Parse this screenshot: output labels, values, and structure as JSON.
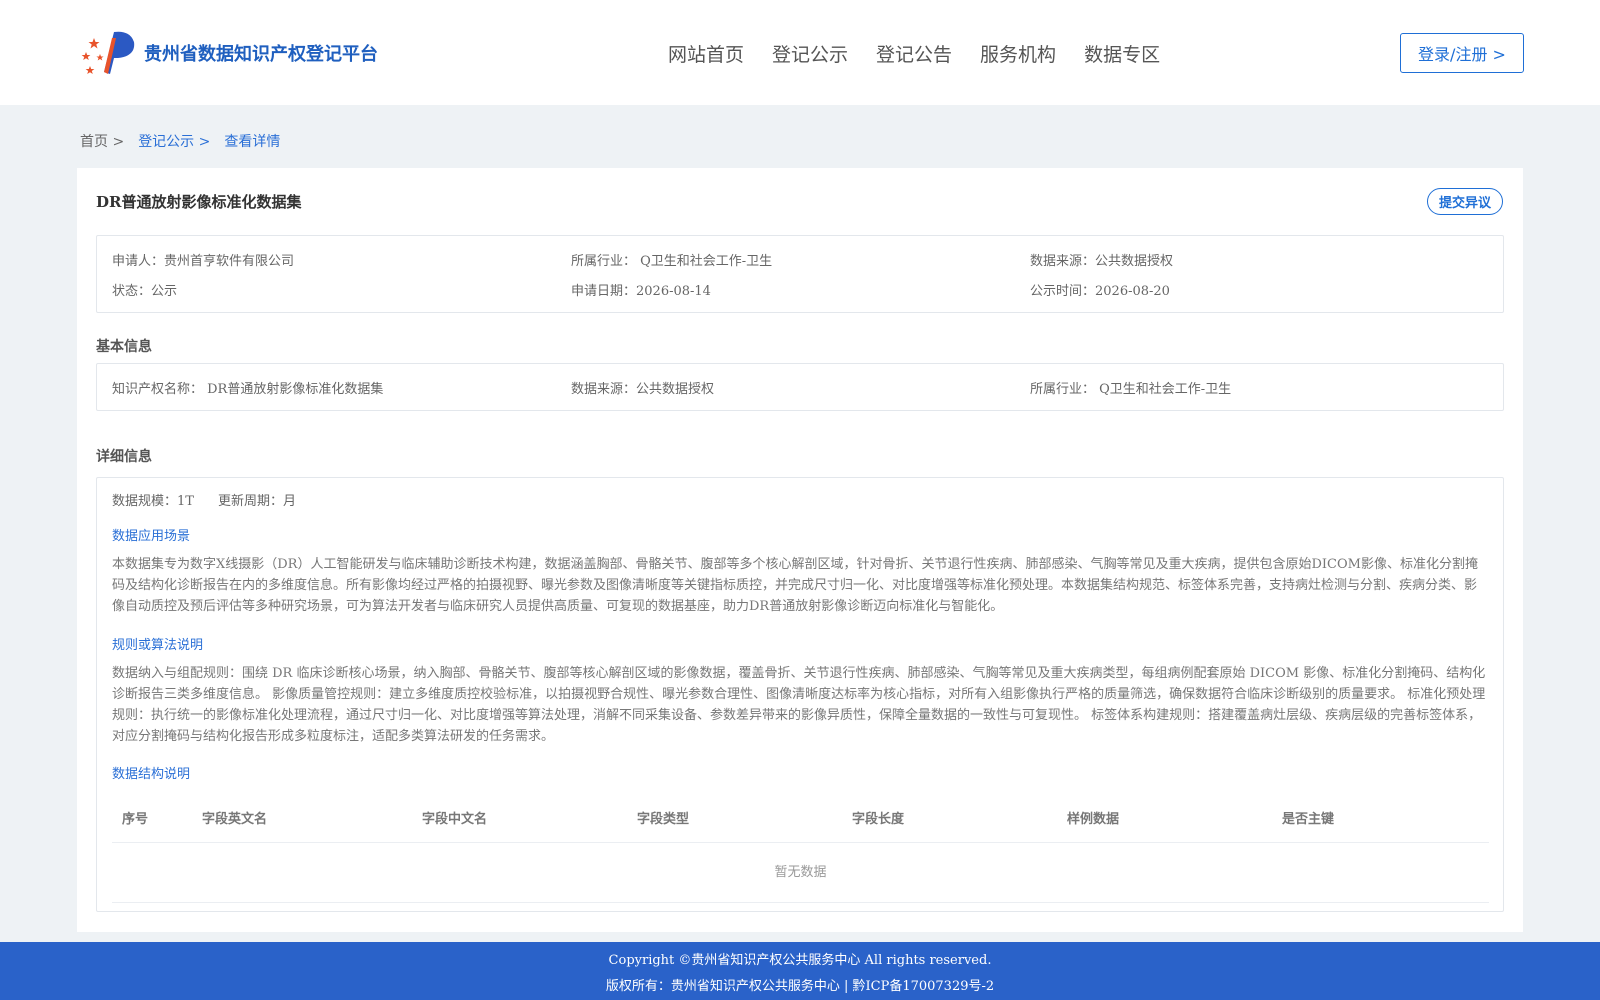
{
  "header": {
    "logo_icon": "platform-logo-icon",
    "platform_name": "贵州省数据知识产权登记平台",
    "nav": [
      "网站首页",
      "登记公示",
      "登记公告",
      "服务机构",
      "数据专区"
    ],
    "login_label": "登录/注册 >"
  },
  "breadcrumb": {
    "home": "首页 >",
    "list": "登记公示 >",
    "current": "查看详情"
  },
  "detail": {
    "title": "DR普通放射影像标准化数据集",
    "objection_label": "提交异议",
    "summary": {
      "applicant": "申请人：贵州首亨软件有限公司",
      "industry": "所属行业： Q卫生和社会工作-卫生",
      "source": "数据来源：公共数据授权",
      "status": "状态：公示",
      "apply_date": "申请日期：2026-08-14",
      "publish_time": "公示时间：2026-08-20"
    },
    "basic_title": "基本信息",
    "basic": {
      "ip_name": "知识产权名称： DR普通放射影像标准化数据集",
      "source": "数据来源：公共数据授权",
      "industry": "所属行业： Q卫生和社会工作-卫生"
    },
    "detail_title": "详细信息",
    "scale": "数据规模：1T",
    "update_cycle": "更新周期：月",
    "scenario_title": "数据应用场景",
    "scenario_text": "本数据集专为数字X线摄影（DR）人工智能研发与临床辅助诊断技术构建，数据涵盖胸部、骨骼关节、腹部等多个核心解剖区域，针对骨折、关节退行性疾病、肺部感染、气胸等常见及重大疾病，提供包含原始DICOM影像、标准化分割掩码及结构化诊断报告在内的多维度信息。所有影像均经过严格的拍摄视野、曝光参数及图像清晰度等关键指标质控，并完成尺寸归一化、对比度增强等标准化预处理。本数据集结构规范、标签体系完善，支持病灶检测与分割、疾病分类、影像自动质控及预后评估等多种研究场景，可为算法开发者与临床研究人员提供高质量、可复现的数据基座，助力DR普通放射影像诊断迈向标准化与智能化。",
    "rules_title": "规则或算法说明",
    "rules_text": "数据纳入与组配规则：围绕 DR 临床诊断核心场景，纳入胸部、骨骼关节、腹部等核心解剖区域的影像数据，覆盖骨折、关节退行性疾病、肺部感染、气胸等常见及重大疾病类型，每组病例配套原始 DICOM 影像、标准化分割掩码、结构化诊断报告三类多维度信息。 影像质量管控规则：建立多维度质控校验标准，以拍摄视野合规性、曝光参数合理性、图像清晰度达标率为核心指标，对所有入组影像执行严格的质量筛选，确保数据符合临床诊断级别的质量要求。 标准化预处理规则：执行统一的影像标准化处理流程，通过尺寸归一化、对比度增强等算法处理，消解不同采集设备、参数差异带来的影像异质性，保障全量数据的一致性与可复现性。 标签体系构建规则：搭建覆盖病灶层级、疾病层级的完善标签体系，对应分割掩码与结构化报告形成多粒度标注，适配多类算法研发的任务需求。",
    "structure_title": "数据结构说明",
    "table_headers": [
      "序号",
      "字段英文名",
      "字段中文名",
      "字段类型",
      "字段长度",
      "样例数据",
      "是否主键"
    ],
    "empty_text": "暂无数据"
  },
  "footer": {
    "copyright": "Copyright ©贵州省知识产权公共服务中心 All rights reserved.",
    "owner": "版权所有：贵州省知识产权公共服务中心 | 黔ICP备17007329号-2"
  }
}
